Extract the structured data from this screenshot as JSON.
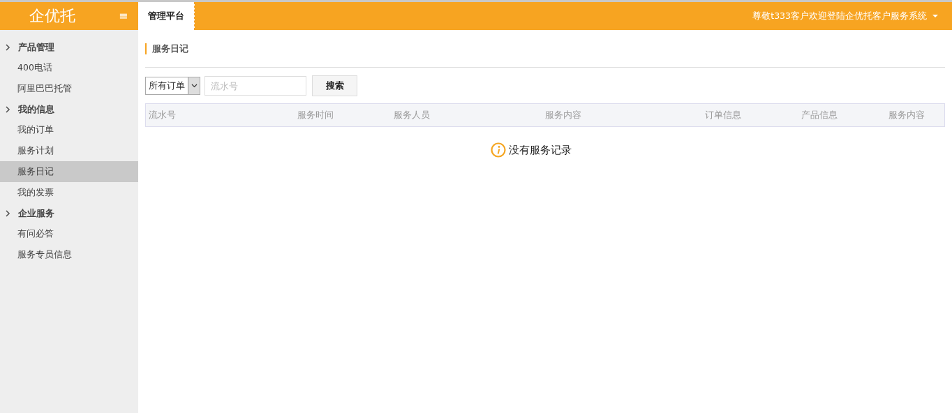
{
  "header": {
    "logo": "企优托",
    "menu_icon": "≡",
    "tabs": [
      {
        "label": "管理平台",
        "selected": true
      }
    ],
    "user_greeting": "尊敬t333客户欢迎登陆企优托客户服务系统"
  },
  "sidebar": {
    "groups": [
      {
        "label": "产品管理",
        "children": [
          {
            "label": "400电话",
            "selected": false
          },
          {
            "label": "阿里巴巴托管",
            "selected": false
          }
        ]
      },
      {
        "label": "我的信息",
        "children": [
          {
            "label": "我的订单",
            "selected": false
          },
          {
            "label": "服务计划",
            "selected": false
          },
          {
            "label": "服务日记",
            "selected": true
          },
          {
            "label": "我的发票",
            "selected": false
          }
        ]
      },
      {
        "label": "企业服务",
        "children": [
          {
            "label": "有问必答",
            "selected": false
          },
          {
            "label": "服务专员信息",
            "selected": false
          }
        ]
      }
    ]
  },
  "page_title": "服务日记",
  "filter": {
    "select_value": "所有订单",
    "search_placeholder": "流水号",
    "search_button": "搜索"
  },
  "table": {
    "columns": [
      "流水号",
      "服务时间",
      "服务人员",
      "服务内容",
      "订单信息",
      "产品信息",
      "服务内容"
    ],
    "empty_message": "没有服务记录"
  }
}
